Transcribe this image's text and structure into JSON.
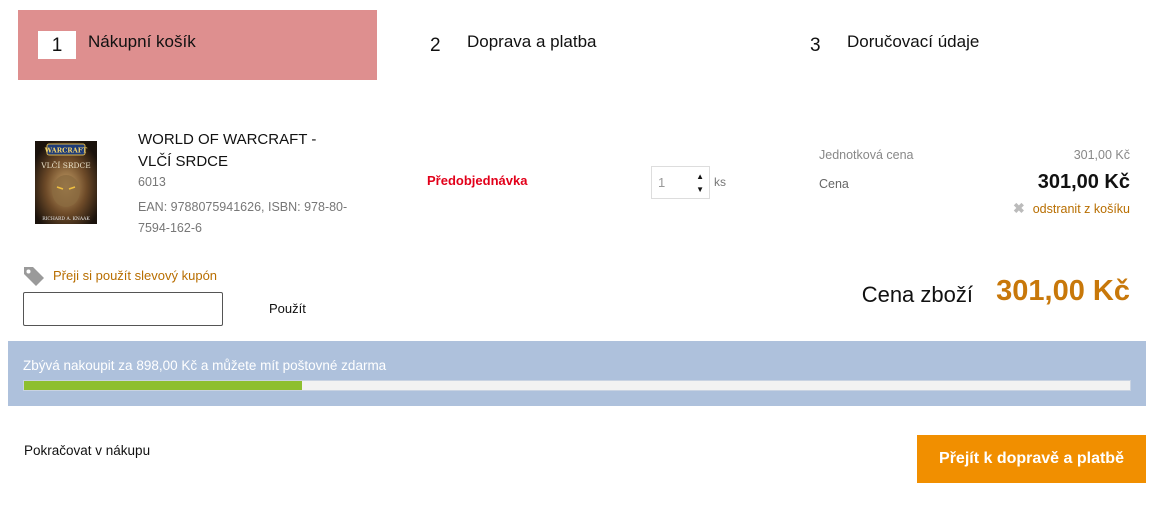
{
  "steps": [
    {
      "number": "1",
      "label": "Nákupní košík",
      "active": true
    },
    {
      "number": "2",
      "label": "Doprava a platba",
      "active": false
    },
    {
      "number": "3",
      "label": "Doručovací údaje",
      "active": false
    }
  ],
  "cart": {
    "items": [
      {
        "cover_lines": [
          "WARCRAFT",
          "VLČÍ SRDCE",
          "RICHARD A. KNAAK"
        ],
        "title": "WORLD OF WARCRAFT - VLČÍ SRDCE",
        "code": "6013",
        "ean": "EAN: 9788075941626, ISBN: 978-80-7594-162-6",
        "availability": "Předobjednávka",
        "quantity": "1",
        "unit": "ks",
        "unit_price_label": "Jednotková cena",
        "unit_price": "301,00 Kč",
        "price_label": "Cena",
        "price": "301,00 Kč",
        "remove_label": "odstranit z košíku"
      }
    ]
  },
  "coupon": {
    "link_label": "Přeji si použít slevový kupón",
    "input_value": "",
    "apply_label": "Použít"
  },
  "summary": {
    "total_label": "Cena zboží",
    "total_value": "301,00 Kč"
  },
  "free_shipping": {
    "text": "Zbývá nakoupit za 898,00 Kč a můžete mít poštovné zdarma",
    "progress_fraction": 0.251
  },
  "footer": {
    "continue_label": "Pokračovat v nákupu",
    "next_label": "Přejít k dopravě a platbě"
  },
  "colors": {
    "active_step": "#de8f8f",
    "accent_orange": "#f18f00",
    "price_orange": "#c8780a",
    "link_brown": "#b86e00",
    "preorder_red": "#e2001a",
    "shipping_panel": "#aec1dc",
    "progress_green": "#8ebf2f"
  }
}
